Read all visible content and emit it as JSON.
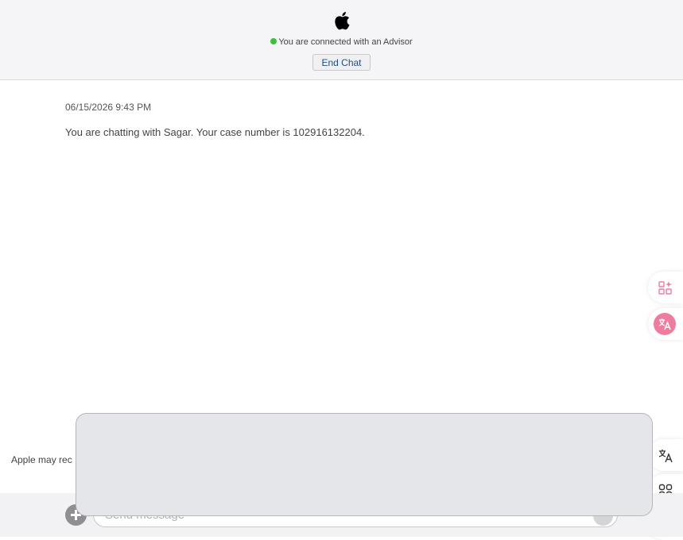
{
  "header": {
    "logo_icon": "apple-logo-icon",
    "status_text": "You are connected with an Advisor",
    "status_color": "#3fbf3f",
    "end_chat_label": "End Chat"
  },
  "chat": {
    "timestamp": "06/15/2026 9:43 PM",
    "message": "You are chatting with Sagar. Your case number is 102916132204."
  },
  "footer": {
    "disclaimer": "Apple may rec",
    "input_placeholder": "Send message",
    "add_icon": "plus-icon",
    "send_icon": "send-icon"
  },
  "side_tools": [
    {
      "icon": "apps-sparkle-icon"
    },
    {
      "icon": "translate-pink-icon",
      "color": "#f07b9c"
    },
    {
      "icon": "translate-icon"
    },
    {
      "icon": "grid-icon"
    },
    {
      "icon": "assistant-face-icon"
    }
  ]
}
